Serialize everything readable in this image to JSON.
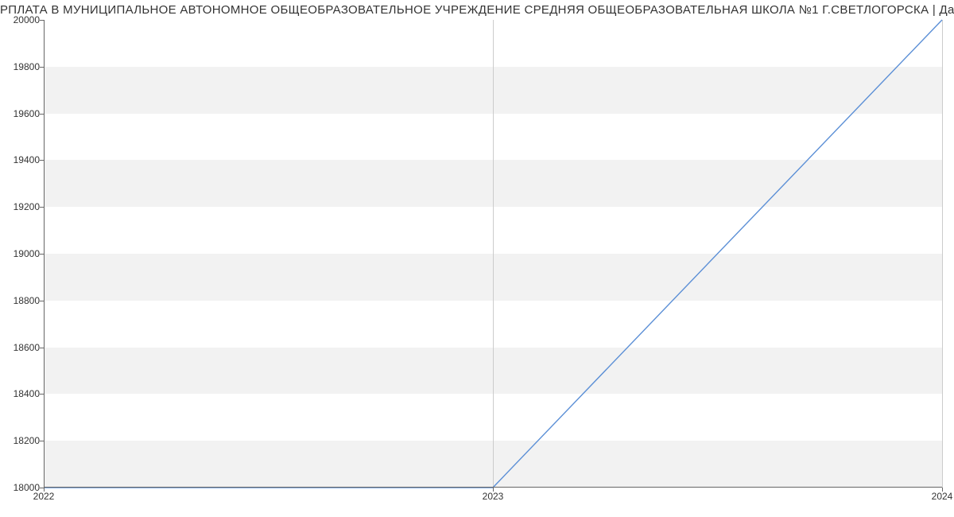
{
  "chart_data": {
    "type": "line",
    "title": "РПЛАТА В МУНИЦИПАЛЬНОЕ АВТОНОМНОЕ ОБЩЕОБРАЗОВАТЕЛЬНОЕ УЧРЕЖДЕНИЕ СРЕДНЯЯ ОБЩЕОБРАЗОВАТЕЛЬНАЯ ШКОЛА №1 Г.СВЕТЛОГОРСКА | Данные mnogo.wo",
    "x": [
      2022,
      2023,
      2024
    ],
    "values": [
      18000,
      18000,
      20000
    ],
    "xlabel": "",
    "ylabel": "",
    "xlim": [
      2022,
      2024
    ],
    "ylim": [
      18000,
      20000
    ],
    "x_ticks": [
      2022,
      2023,
      2024
    ],
    "y_ticks": [
      18000,
      18200,
      18400,
      18600,
      18800,
      19000,
      19200,
      19400,
      19600,
      19800,
      20000
    ],
    "line_color": "#5b8fd6"
  }
}
